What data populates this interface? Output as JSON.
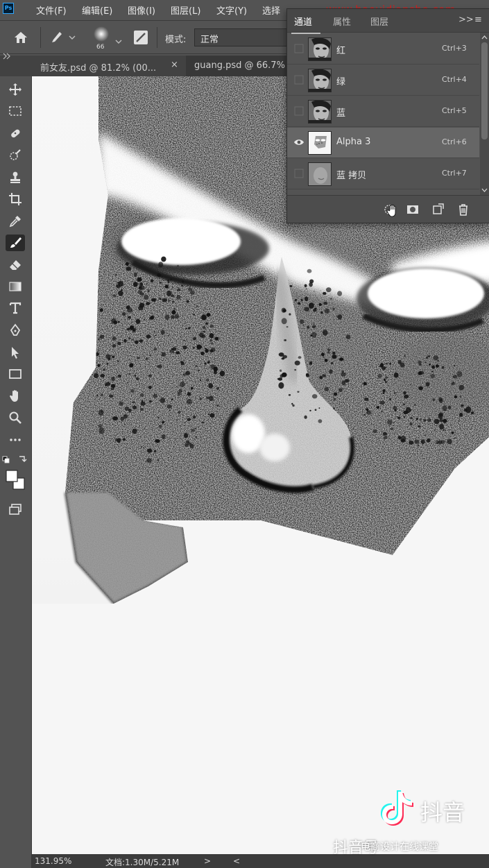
{
  "menubar": {
    "app_icon": "Ps",
    "items": [
      "文件(F)",
      "编辑(E)",
      "图像(I)",
      "图层(L)",
      "文字(Y)",
      "选择"
    ],
    "watermark_url": "www.haoyidianshe.com"
  },
  "options": {
    "brush_size": "66",
    "mode_label": "模式:",
    "mode_value": "正常"
  },
  "tabs": [
    {
      "label": "前女友.psd @ 81.2% (00...",
      "close": "×"
    },
    {
      "label": "guang.psd @ 66.7%"
    }
  ],
  "toolbar": {
    "icons": [
      "move-icon",
      "marquee-icon",
      "healing-brush-icon",
      "quick-select-icon",
      "stamp-icon",
      "crop-icon",
      "eyedropper-icon",
      "brush-icon",
      "eraser-icon",
      "gradient-icon",
      "type-icon",
      "pen-icon",
      "path-select-icon",
      "rectangle-icon",
      "hand-icon",
      "zoom-icon",
      "more-icon",
      "swap-colors-icon",
      "color-swatches-icon",
      "screen-mode-icon"
    ],
    "active": "brush-icon"
  },
  "statusbar": {
    "zoom": "131.95%",
    "doc": "文档:1.30M/5.21M",
    "arrow": ">",
    "scroll_left": "<"
  },
  "panel": {
    "tabs": {
      "channels": "通道",
      "properties": "属性",
      "layers": "图层"
    },
    "collapse": ">>",
    "menu": "≡",
    "rows": [
      {
        "name": "红",
        "shortcut": "Ctrl+3",
        "visible": false,
        "selected": false,
        "kind": "photo"
      },
      {
        "name": "绿",
        "shortcut": "Ctrl+4",
        "visible": false,
        "selected": false,
        "kind": "photo"
      },
      {
        "name": "蓝",
        "shortcut": "Ctrl+5",
        "visible": false,
        "selected": false,
        "kind": "photo"
      },
      {
        "name": "Alpha 3",
        "shortcut": "Ctrl+6",
        "visible": true,
        "selected": true,
        "kind": "mask"
      },
      {
        "name": "蓝 拷贝",
        "shortcut": "Ctrl+7",
        "visible": false,
        "selected": false,
        "kind": "gray"
      }
    ],
    "footer_icons": [
      "load-selection-icon",
      "save-mask-icon",
      "new-channel-icon",
      "delete-icon"
    ]
  },
  "watermark": {
    "douyin": "抖音",
    "douyin_id": "抖音号",
    "caption": "电商设计在线课堂"
  },
  "colors": {
    "ui_bg": "#535353",
    "panel_selected": "#666666",
    "canvas_bg": "#f5f5f5",
    "watermark_red": "#d41c1c"
  }
}
